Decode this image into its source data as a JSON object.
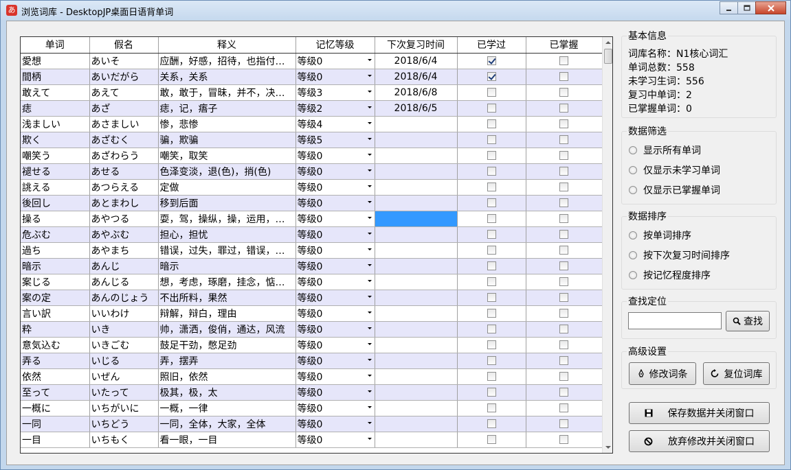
{
  "window": {
    "title": "浏览词库 - DesktopJP桌面日语背单词",
    "icon_char": "あ"
  },
  "grid": {
    "headers": [
      "单词",
      "假名",
      "释义",
      "记忆等级",
      "下次复习时间",
      "已学过",
      "已掌握"
    ],
    "rows": [
      {
        "word": "愛想",
        "kana": "あいそ",
        "meaning": "应酬，好感，招待，也指付…",
        "level": "等级0",
        "date": "2018/6/4",
        "learned": true,
        "mastered": false
      },
      {
        "word": "間柄",
        "kana": "あいだがら",
        "meaning": "关系，关系",
        "level": "等级0",
        "date": "2018/6/4",
        "learned": true,
        "mastered": false
      },
      {
        "word": "敢えて",
        "kana": "あえて",
        "meaning": "敢，敢于，冒昧，并不，决…",
        "level": "等级3",
        "date": "2018/6/8",
        "learned": false,
        "mastered": false
      },
      {
        "word": "痣",
        "kana": "あざ",
        "meaning": "痣，记，痦子",
        "level": "等级2",
        "date": "2018/6/5",
        "learned": false,
        "mastered": false
      },
      {
        "word": "浅ましい",
        "kana": "あさましい",
        "meaning": "惨，悲惨",
        "level": "等级4",
        "date": "",
        "learned": false,
        "mastered": false
      },
      {
        "word": "欺く",
        "kana": "あざむく",
        "meaning": "骗，欺骗",
        "level": "等级5",
        "date": "",
        "learned": false,
        "mastered": false
      },
      {
        "word": "嘲笑う",
        "kana": "あざわらう",
        "meaning": "嘲笑，取笑",
        "level": "等级0",
        "date": "",
        "learned": false,
        "mastered": false
      },
      {
        "word": "褪せる",
        "kana": "あせる",
        "meaning": "色泽变淡，退(色)，捎(色)",
        "level": "等级0",
        "date": "",
        "learned": false,
        "mastered": false
      },
      {
        "word": "誂える",
        "kana": "あつらえる",
        "meaning": "定做",
        "level": "等级0",
        "date": "",
        "learned": false,
        "mastered": false
      },
      {
        "word": "後回し",
        "kana": "あとまわし",
        "meaning": "移到后面",
        "level": "等级0",
        "date": "",
        "learned": false,
        "mastered": false
      },
      {
        "word": "操る",
        "kana": "あやつる",
        "meaning": "耍，驾，操纵，操，运用，…",
        "level": "等级0",
        "date": "",
        "learned": false,
        "mastered": false,
        "selected_date": true
      },
      {
        "word": "危ぶむ",
        "kana": "あやぶむ",
        "meaning": "担心，担忧",
        "level": "等级0",
        "date": "",
        "learned": false,
        "mastered": false
      },
      {
        "word": "過ち",
        "kana": "あやまち",
        "meaning": "错误，过失，罪过，错误，…",
        "level": "等级0",
        "date": "",
        "learned": false,
        "mastered": false
      },
      {
        "word": "暗示",
        "kana": "あんじ",
        "meaning": "暗示",
        "level": "等级0",
        "date": "",
        "learned": false,
        "mastered": false
      },
      {
        "word": "案じる",
        "kana": "あんじる",
        "meaning": "想，考虑，琢磨，挂念，惦…",
        "level": "等级0",
        "date": "",
        "learned": false,
        "mastered": false
      },
      {
        "word": "案の定",
        "kana": "あんのじょう",
        "meaning": "不出所料，果然",
        "level": "等级0",
        "date": "",
        "learned": false,
        "mastered": false
      },
      {
        "word": "言い訳",
        "kana": "いいわけ",
        "meaning": "辩解，辩白，理由",
        "level": "等级0",
        "date": "",
        "learned": false,
        "mastered": false
      },
      {
        "word": "粋",
        "kana": "いき",
        "meaning": "帅，潇洒，俊俏，通达，风流",
        "level": "等级0",
        "date": "",
        "learned": false,
        "mastered": false
      },
      {
        "word": "意気込む",
        "kana": "いきごむ",
        "meaning": "鼓足干劲，憋足劲",
        "level": "等级0",
        "date": "",
        "learned": false,
        "mastered": false
      },
      {
        "word": "弄る",
        "kana": "いじる",
        "meaning": "弄，摆弄",
        "level": "等级0",
        "date": "",
        "learned": false,
        "mastered": false
      },
      {
        "word": "依然",
        "kana": "いぜん",
        "meaning": "照旧，依然",
        "level": "等级0",
        "date": "",
        "learned": false,
        "mastered": false
      },
      {
        "word": "至って",
        "kana": "いたって",
        "meaning": "极其，极，太",
        "level": "等级0",
        "date": "",
        "learned": false,
        "mastered": false
      },
      {
        "word": "一概に",
        "kana": "いちがいに",
        "meaning": "一概，一律",
        "level": "等级0",
        "date": "",
        "learned": false,
        "mastered": false
      },
      {
        "word": "一同",
        "kana": "いちどう",
        "meaning": "一同，全体，大家，全体",
        "level": "等级0",
        "date": "",
        "learned": false,
        "mastered": false
      },
      {
        "word": "一目",
        "kana": "いちもく",
        "meaning": "看一眼，一目",
        "level": "等级0",
        "date": "",
        "learned": false,
        "mastered": false
      }
    ]
  },
  "info": {
    "title": "基本信息",
    "lines": [
      "词库名称：N1核心词汇",
      "单词总数：558",
      "未学习生词：556",
      "复习中单词：2",
      "已掌握单词：0"
    ]
  },
  "filter": {
    "title": "数据筛选",
    "options": [
      "显示所有单词",
      "仅显示未学习单词",
      "仅显示已掌握单词"
    ]
  },
  "sort": {
    "title": "数据排序",
    "options": [
      "按单词排序",
      "按下次复习时间排序",
      "按记忆程度排序"
    ]
  },
  "search": {
    "title": "查找定位",
    "value": "",
    "button": "查找"
  },
  "advanced": {
    "title": "高级设置",
    "edit_button": "修改词条",
    "reset_button": "复位词库"
  },
  "actions": {
    "save_button": "保存数据并关闭窗口",
    "discard_button": "放弃修改并关闭窗口"
  }
}
